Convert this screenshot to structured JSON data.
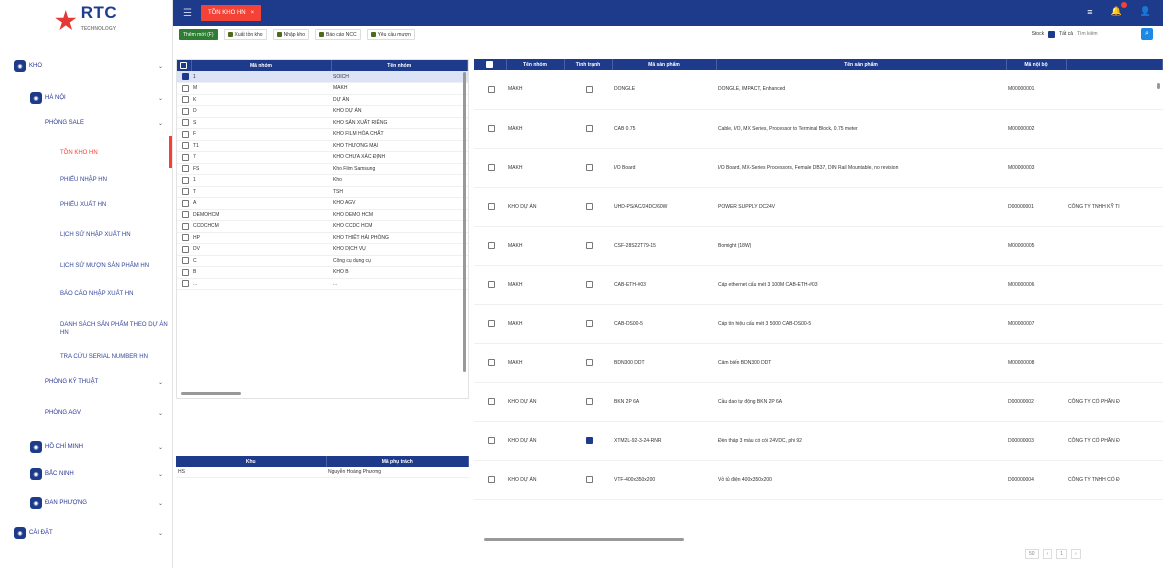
{
  "logo": {
    "text": "RTC",
    "subtext": "TECHNOLOGY"
  },
  "sidebar": {
    "items": [
      {
        "label": "KHO",
        "badge": "◉",
        "chevron": "⌄",
        "level": 0
      },
      {
        "label": "HÀ NỘI",
        "badge": "◉",
        "chevron": "⌄",
        "level": 1
      },
      {
        "label": "PHÒNG SALE",
        "chevron": "⌄",
        "level": 2
      },
      {
        "label": "TỒN KHO HN",
        "level": 3,
        "active": true
      },
      {
        "label": "PHIẾU NHẬP HN",
        "level": 3
      },
      {
        "label": "PHIẾU XUẤT HN",
        "level": 3
      },
      {
        "label": "LỊCH SỬ NHẬP XUẤT HN",
        "level": 3
      },
      {
        "label": "LỊCH SỬ MƯỢN SẢN PHẨM HN",
        "level": 3
      },
      {
        "label": "BÁO CÁO NHẬP XUẤT HN",
        "level": 3
      },
      {
        "label": "DANH SÁCH SẢN PHẨM THEO DỰ ÁN HN",
        "level": 3
      },
      {
        "label": "TRA CỨU SERIAL NUMBER HN",
        "level": 3
      },
      {
        "label": "PHÒNG KỸ THUẬT",
        "chevron": "⌄",
        "level": 2
      },
      {
        "label": "PHÒNG AGV",
        "chevron": "⌄",
        "level": 2
      },
      {
        "label": "HỒ CHÍ MINH",
        "badge": "◉",
        "chevron": "⌄",
        "level": 1
      },
      {
        "label": "BẮC NINH",
        "badge": "◉",
        "chevron": "⌄",
        "level": 1
      },
      {
        "label": "ĐAN PHƯỢNG",
        "badge": "◉",
        "chevron": "⌄",
        "level": 1
      },
      {
        "label": "CÀI ĐẶT",
        "badge": "◉",
        "chevron": "⌄",
        "level": 0
      }
    ]
  },
  "topbar": {
    "menu_icon": "☰",
    "active_tab": "TỒN KHO HN",
    "tab_close": "×",
    "right_icons": [
      "≡",
      "🔔",
      "👤"
    ]
  },
  "toolbar": {
    "buttons": [
      "Thêm mới (F)",
      "Xuất tồn kho",
      "Nhập kho",
      "Báo cáo NCC",
      "Yêu cầu mượn"
    ],
    "stock_label": "Stock",
    "all_label": "Tất cả",
    "search_placeholder": "Tìm kiếm",
    "search_icon": "⌕"
  },
  "warehouse_table": {
    "headers": [
      "",
      "Mã nhóm",
      "Tên nhóm"
    ],
    "rows": [
      {
        "code": "1",
        "name": "SOICH",
        "checked": true,
        "selected": true
      },
      {
        "code": "M",
        "name": "MAKH",
        "checked": false
      },
      {
        "code": "K",
        "name": "DỰ ÁN",
        "checked": false
      },
      {
        "code": "D",
        "name": "KHO DỰ ÁN",
        "checked": false
      },
      {
        "code": "S",
        "name": "KHO SẢN XUẤT RIÊNG",
        "checked": false
      },
      {
        "code": "F",
        "name": "KHO FILM HÓA CHẤT",
        "checked": false
      },
      {
        "code": "T1",
        "name": "KHO THƯƠNG MẠI",
        "checked": false
      },
      {
        "code": "7",
        "name": "KHO CHƯA XÁC ĐỊNH",
        "checked": false
      },
      {
        "code": "FS",
        "name": "Kho Film Samsung",
        "checked": false
      },
      {
        "code": "1",
        "name": "Kho",
        "checked": false
      },
      {
        "code": "T",
        "name": "TSH",
        "checked": false
      },
      {
        "code": "A",
        "name": "KHO AGV",
        "checked": false
      },
      {
        "code": "DEMOHCM",
        "name": "KHO DEMO HCM",
        "checked": false
      },
      {
        "code": "CCDCHCM",
        "name": "KHO CCDC HCM",
        "checked": false
      },
      {
        "code": "HP",
        "name": "KHO THIẾT HẢI PHÒNG",
        "checked": false
      },
      {
        "code": "DV",
        "name": "KHO DỊCH VỤ",
        "checked": false
      },
      {
        "code": "C",
        "name": "Công cụ dụng cụ",
        "checked": false
      },
      {
        "code": "B",
        "name": "KHO B",
        "checked": false
      },
      {
        "code": "...",
        "name": "...",
        "checked": false
      }
    ]
  },
  "area_table": {
    "headers": [
      "Khu",
      "Mã phụ trách"
    ],
    "rows": [
      {
        "area": "HS",
        "owner": "Nguyễn Hoàng Phương"
      }
    ]
  },
  "product_table": {
    "headers": [
      "",
      "Tên nhóm",
      "Tình trạnh",
      "Mã sản phẩm",
      "Tên sản phẩm",
      "Mã nội bộ",
      ""
    ],
    "rows": [
      {
        "group": "MAKH",
        "checked": false,
        "code": "DONGLE",
        "name": "DONGLE, IMPACT, Enhanced",
        "internal": "M00000001",
        "extra": ""
      },
      {
        "group": "MAKH",
        "checked": false,
        "code": "CAB 0.75",
        "name": "Cable, I/O, MX Series, Processor to Terminal Block, 0.75 meter",
        "internal": "M00000002",
        "extra": ""
      },
      {
        "group": "MAKH",
        "checked": false,
        "code": "I/O Board",
        "name": "I/O Board, MX-Series Processors, Female DB37, DIN Rail Mountable, no revision",
        "internal": "M00000003",
        "extra": ""
      },
      {
        "group": "KHO DỰ ÁN",
        "checked": false,
        "code": "UHD-PS/AC/24DC/60W",
        "name": "POWER SUPPLY DC24V",
        "internal": "D00000001",
        "extra": "CÔNG TY TNHH KỸ TI"
      },
      {
        "group": "MAKH",
        "checked": false,
        "code": "CSF-28S22T79-15",
        "name": "Bomight (18W)",
        "internal": "M00000005",
        "extra": ""
      },
      {
        "group": "MAKH",
        "checked": false,
        "code": "CAB-ETH-#03",
        "name": "Cáp ethernet cấu mét 3 100M CAB-ETH-#03",
        "internal": "M00000006",
        "extra": ""
      },
      {
        "group": "MAKH",
        "checked": false,
        "code": "CAB-DS00-5",
        "name": "Cáp tín hiệu cấu mét 3 5000 CAB-DS00-5",
        "internal": "M00000007",
        "extra": ""
      },
      {
        "group": "MAKH",
        "checked": false,
        "code": "BDN300 DDT",
        "name": "Cảm biến BDN300 DDT",
        "internal": "M00000008",
        "extra": ""
      },
      {
        "group": "KHO DỰ ÁN",
        "checked": false,
        "code": "BKN 2P 6A",
        "name": "Cầu dao tự động BKN 2P 6A",
        "internal": "D00000002",
        "extra": "CÔNG TY CỔ PHẦN Đ"
      },
      {
        "group": "KHO DỰ ÁN",
        "checked": true,
        "code": "XTM2L-92-3-24-RNR",
        "name": "Đèn tháp 3 màu có còi 24VDC, phi 92",
        "internal": "D00000003",
        "extra": "CÔNG TY CỔ PHẦN Đ"
      },
      {
        "group": "KHO DỰ ÁN",
        "checked": false,
        "code": "VTF-400x350x200",
        "name": "Vỏ tủ điện 400x350x200",
        "internal": "D00000004",
        "extra": "CÔNG TY TNHH CỔ Đ"
      }
    ]
  },
  "pager": {
    "page_size": "50",
    "page_info": "1"
  }
}
